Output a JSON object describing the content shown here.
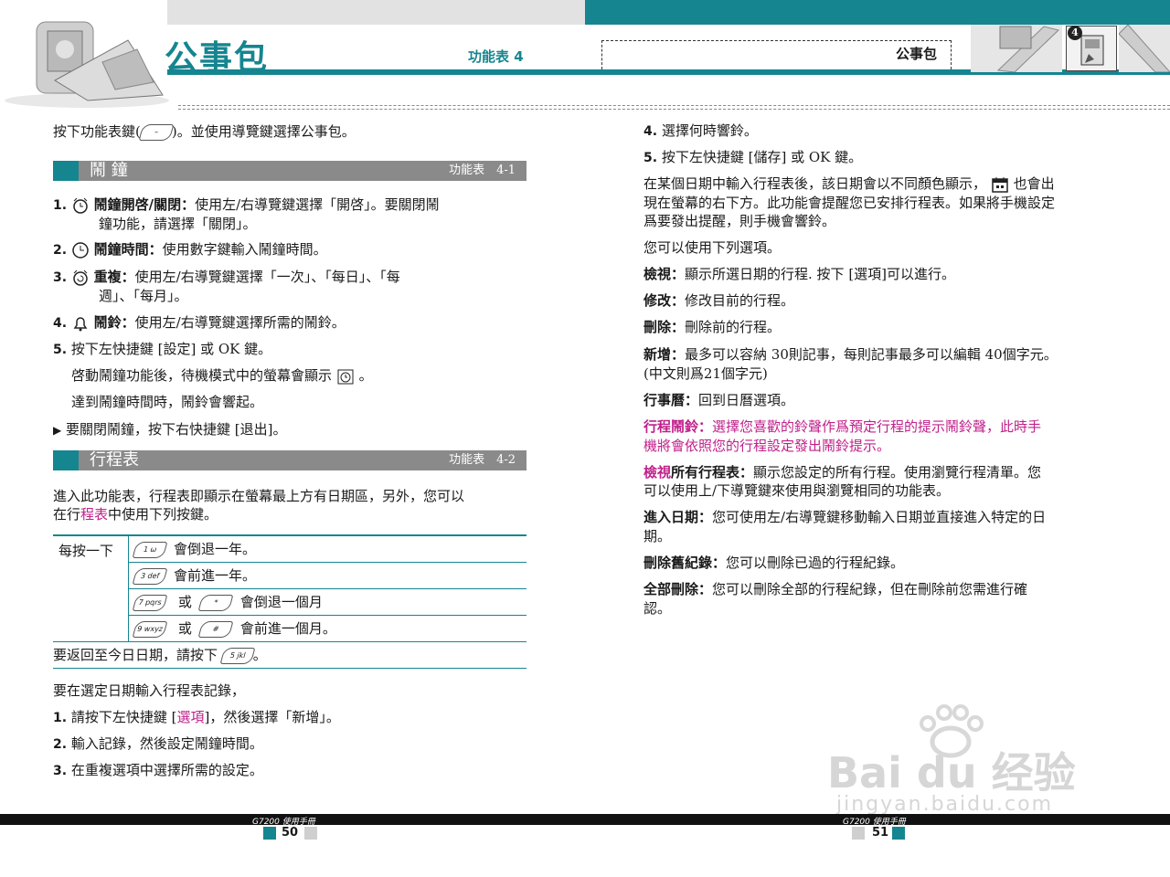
{
  "header": {
    "title": "公事包",
    "menu_label": "功能表 4",
    "right_title": "公事包",
    "badge_number": "4"
  },
  "intro": {
    "text_a": "按下功能表鍵(",
    "key_glyph": "–",
    "text_b": ")。並使用導覽鍵選擇公事包。"
  },
  "section_alarm": {
    "title": "鬧 鐘",
    "code": "功能表　4-1"
  },
  "alarm_items": [
    {
      "num": "1.",
      "bold": "鬧鐘開啓/關閉：",
      "text": "使用左/右導覽鍵選擇「開啓」。要關閉鬧",
      "text2": "鐘功能，請選擇「關閉」。"
    },
    {
      "num": "2.",
      "bold": "鬧鐘時間：",
      "text": "使用數字鍵輸入鬧鐘時間。"
    },
    {
      "num": "3.",
      "bold": "重複：",
      "text": "使用左/右導覽鍵選擇「一次」、「每日」、「每",
      "text2": "週」、「每月」。"
    },
    {
      "num": "4.",
      "bold": "鬧鈴：",
      "text": "使用左/右導覽鍵選擇所需的鬧鈴。"
    },
    {
      "num": "5.",
      "text": "按下左快捷鍵 [設定] 或 OK 鍵。"
    }
  ],
  "alarm_notes": {
    "standby_a": "啓動鬧鐘功能後，待機模式中的螢幕會顯示",
    "standby_b": "。",
    "ring": "達到鬧鐘時間時，鬧鈴會響起。",
    "close": "要關閉鬧鐘，按下右快捷鍵 [退出]。"
  },
  "section_sched": {
    "title": "行程表",
    "code": "功能表　4-2"
  },
  "sched_intro": {
    "line1": "進入此功能表，行程表即顯示在螢幕最上方有日期區，另外，您可以",
    "line2_a": "在行",
    "line2_link": "程表",
    "line2_b": "中使用下列按鍵。"
  },
  "key_table": {
    "lead": "每按一下",
    "rows": [
      {
        "key1": "1 ω",
        "text1": "會倒退一年。"
      },
      {
        "key1": "3 def",
        "text1": "會前進一年。"
      },
      {
        "key1": "7 pqrs",
        "or": "或",
        "key2": "* ",
        "text2": "會倒退一個月"
      },
      {
        "key1": "9 wxyz",
        "or": "或",
        "key2": "# ",
        "text2": "會前進一個月。"
      }
    ],
    "today_a": "要返回至今日日期，請按下",
    "today_key": "5 jkl",
    "today_b": "。"
  },
  "sched_entry": {
    "lead": "要在選定日期輸入行程表記錄，",
    "steps": [
      {
        "num": "1.",
        "text_a": "請按下左快捷鍵 [",
        "link": "選項",
        "text_b": "]，然後選擇「新增」。"
      },
      {
        "num": "2.",
        "text": "輸入記錄，然後設定鬧鐘時間。"
      },
      {
        "num": "3.",
        "text": "在重複選項中選擇所需的設定。"
      }
    ]
  },
  "right_col": {
    "step4": {
      "num": "4.",
      "text": "選擇何時響鈴。"
    },
    "step5": {
      "num": "5.",
      "text": "按下左快捷鍵 [儲存] 或 OK 鍵。"
    },
    "para1_a": "在某個日期中輸入行程表後，該日期會以不同顏色顯示，",
    "para1_b": "也會出",
    "para1_c": "現在螢幕的右下方。此功能會提醒您已安排行程表。如果將手機設定",
    "para1_d": "爲要發出提醒，則手機會響鈴。",
    "options_lead": "您可以使用下列選項。",
    "opts": [
      {
        "bold": "檢視：",
        "text": "顯示所選日期的行程. 按下 [選項]可以進行。"
      },
      {
        "bold": "修改：",
        "text": "修改目前的行程。"
      },
      {
        "bold": "刪除：",
        "text": "刪除前的行程。"
      }
    ],
    "add": {
      "bold": "新增：",
      "text": "最多可以容納 30則記事，每則記事最多可以編輯 40個字元。",
      "text2": "(中文則爲21個字元)"
    },
    "calendar": {
      "bold": "行事曆：",
      "text": "回到日曆選項。"
    },
    "ring": {
      "bold": "行程鬧鈴：",
      "text": "選擇您喜歡的鈴聲作爲預定行程的提示鬧鈴聲，此時手",
      "text2": "機將會依照您的行程設定發出鬧鈴提示。"
    },
    "viewall": {
      "bold_mag": "檢視",
      "bold": "所有行程表：",
      "text": "顯示您設定的所有行程。使用瀏覽行程清單。您",
      "text2": "可以使用上/下導覽鍵來使用與瀏覽相同的功能表。"
    },
    "gotodate": {
      "bold": "進入日期：",
      "text": "您可使用左/右導覽鍵移動輸入日期並直接進入特定的日",
      "text2": "期。"
    },
    "delold": {
      "bold": "刪除舊紀錄：",
      "text": "您可以刪除已過的行程紀錄。"
    },
    "delall": {
      "bold": "全部刪除：",
      "text": "您可以刪除全部的行程紀錄，但在刪除前您需進行確",
      "text2": "認。"
    }
  },
  "footer": {
    "left_manual": "G7200 使用手冊",
    "left_page": "50",
    "right_manual": "G7200 使用手冊",
    "right_page": "51"
  },
  "watermark": {
    "brand": "Bai du 经验",
    "url": "jingyan.baidu.com"
  },
  "colors": {
    "accent": "#158590",
    "section_grey": "#8a8a8a",
    "highlight": "#c0208a"
  }
}
